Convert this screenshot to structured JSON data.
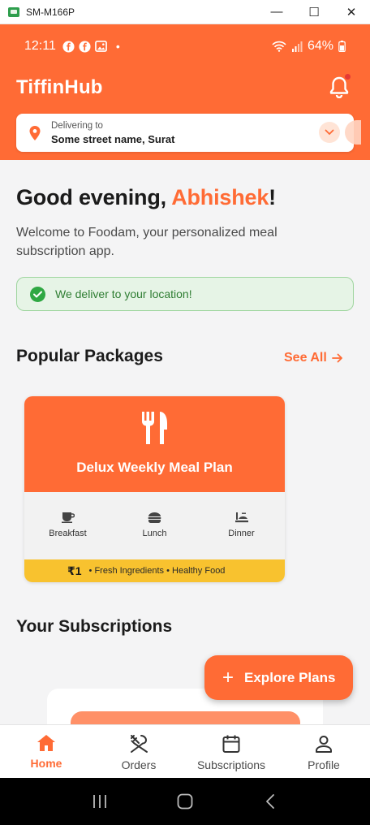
{
  "window": {
    "title": "SM-M166P",
    "minimize": "—",
    "maximize": "☐",
    "close": "✕"
  },
  "status_bar": {
    "time": "12:11",
    "dot": "•",
    "battery": "64%"
  },
  "header": {
    "app_title": "TiffinHub"
  },
  "location": {
    "label": "Delivering to",
    "value": "Some street name, Surat"
  },
  "greeting": {
    "prefix": "Good evening, ",
    "name": "Abhishek",
    "suffix": "!",
    "welcome": "Welcome to Foodam, your personalized meal subscription app."
  },
  "delivery_banner": {
    "text": "We deliver to your location!"
  },
  "popular": {
    "title": "Popular Packages",
    "see_all": "See All"
  },
  "package": {
    "name": "Delux Weekly Meal Plan",
    "meals": [
      {
        "label": "Breakfast",
        "icon": "coffee-cup-icon"
      },
      {
        "label": "Lunch",
        "icon": "burger-icon"
      },
      {
        "label": "Dinner",
        "icon": "dinner-icon"
      }
    ],
    "price": "₹1",
    "features": "• Fresh Ingredients • Healthy Food"
  },
  "subscriptions": {
    "title": "Your Subscriptions"
  },
  "fab": {
    "plus": "+",
    "label": "Explore Plans"
  },
  "bottom_nav": {
    "items": [
      {
        "label": "Home",
        "icon": "home-icon",
        "active": true
      },
      {
        "label": "Orders",
        "icon": "fork-spoon-icon",
        "active": false
      },
      {
        "label": "Subscriptions",
        "icon": "calendar-icon",
        "active": false
      },
      {
        "label": "Profile",
        "icon": "person-icon",
        "active": false
      }
    ]
  },
  "colors": {
    "brand": "#ff6b35",
    "accent_yellow": "#f8c22f",
    "success": "#2fa843"
  }
}
